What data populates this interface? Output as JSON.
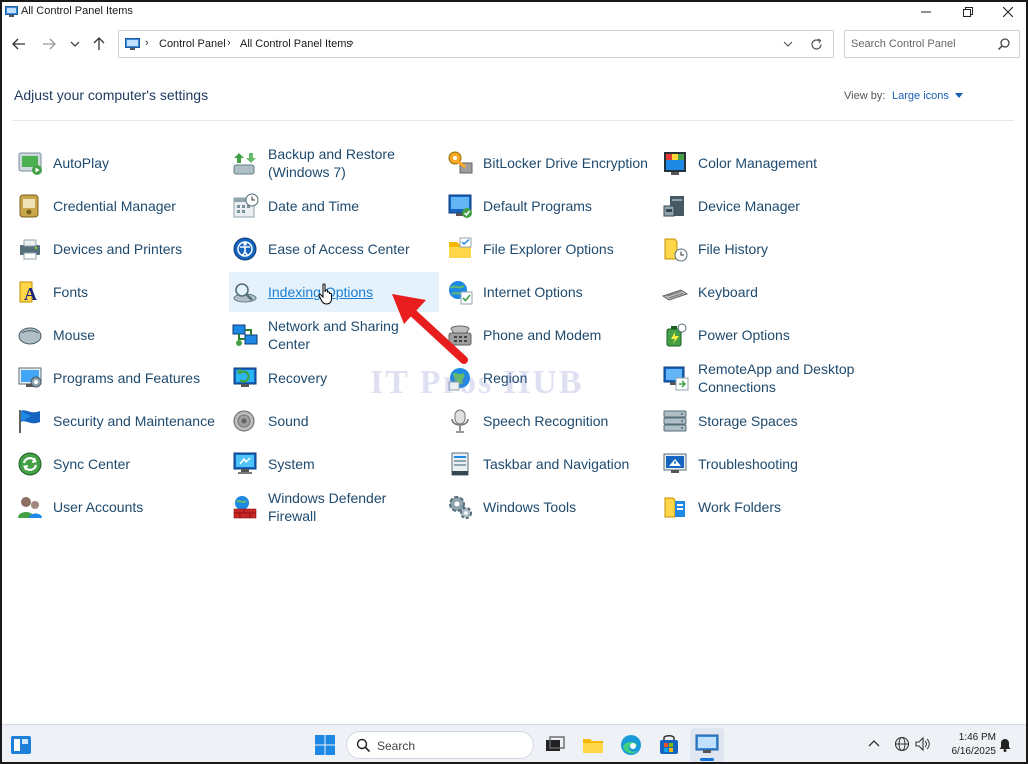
{
  "window": {
    "title": "All Control Panel Items"
  },
  "nav": {
    "breadcrumb": [
      "Control Panel",
      "All Control Panel Items"
    ],
    "search_placeholder": "Search Control Panel"
  },
  "content": {
    "heading": "Adjust your computer's settings",
    "view_by_label": "View by:",
    "view_by_value": "Large icons"
  },
  "items": [
    [
      "AutoPlay",
      "Backup and Restore (Windows 7)",
      "BitLocker Drive Encryption",
      "Color Management"
    ],
    [
      "Credential Manager",
      "Date and Time",
      "Default Programs",
      "Device Manager"
    ],
    [
      "Devices and Printers",
      "Ease of Access Center",
      "File Explorer Options",
      "File History"
    ],
    [
      "Fonts",
      "Indexing Options",
      "Internet Options",
      "Keyboard"
    ],
    [
      "Mouse",
      "Network and Sharing Center",
      "Phone and Modem",
      "Power Options"
    ],
    [
      "Programs and Features",
      "Recovery",
      "Region",
      "RemoteApp and Desktop Connections"
    ],
    [
      "Security and Maintenance",
      "Sound",
      "Speech Recognition",
      "Storage Spaces"
    ],
    [
      "Sync Center",
      "System",
      "Taskbar and Navigation",
      "Troubleshooting"
    ],
    [
      "User Accounts",
      "Windows Defender Firewall",
      "Windows Tools",
      "Work Folders"
    ]
  ],
  "highlighted_item": "Indexing Options",
  "watermark": "IT Pros HUB",
  "taskbar": {
    "search_label": "Search",
    "time": "1:46 PM",
    "date": "6/16/2025"
  },
  "colors": {
    "link_text": "#1e4a6e",
    "hover_bg": "#e5f1fb",
    "arrow": "#e81e1e",
    "accent": "#1a5fb4"
  }
}
